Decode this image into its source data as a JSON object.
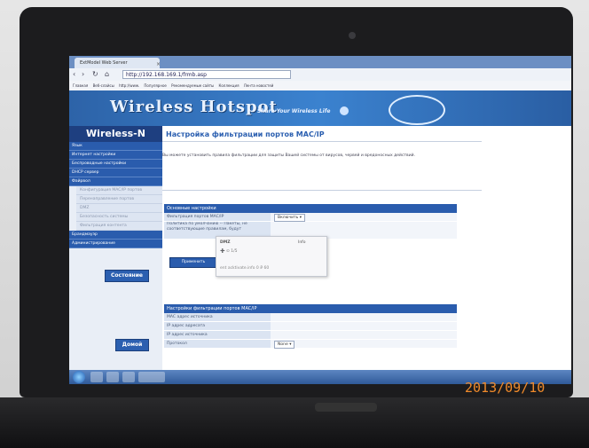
{
  "browser": {
    "tab_title": "ExtModel Web Server",
    "url": "http://192.168.169.1/frmb.asp",
    "bookmarks": [
      "Главная",
      "Веб-слайсы",
      "http://www.",
      "Популярное",
      "Рекомендуемые сайты",
      "Коллекция",
      "Лента новостей"
    ]
  },
  "banner": {
    "title": "Wireless Hotspot",
    "slogan": "Share Your Wireless Life"
  },
  "sidebar": {
    "heading": "Wireless-N",
    "items": [
      "Язык",
      "Интернет настройки",
      "Беспроводные настройки",
      "DHCP сервер",
      "Файрвол"
    ],
    "firewall_subitems": [
      "Конфигурация MAC/IP портов",
      "Перенаправление портов",
      "DMZ",
      "Безопасность системы",
      "Фильтрация контента"
    ],
    "bottom_items": [
      "Брандмауэр",
      "Администрирование"
    ],
    "status_button": "Состояние",
    "home_button": "Домой"
  },
  "main": {
    "heading": "Настройка фильтрации портов MAC/IP",
    "description": "Вы можете установить правила фильтрации для защиты Вашей системы от вирусов, червей и вредоносных действий.",
    "basic_settings": {
      "title": "Основные настройки",
      "rows": [
        {
          "label": "Фильтрация портов MAC/IP",
          "value": "Включить"
        },
        {
          "label": "Политика по умолчанию -- Пакеты, не соответствующие правилам, будут",
          "value": ""
        }
      ],
      "apply_button": "Применить"
    },
    "popup": {
      "title": "DMZ",
      "right": "Info",
      "line2": "➕ ⊙ 1/5",
      "line3": "ent  acktivate.info    0 ₽ 60"
    },
    "filter_settings": {
      "title": "Настройки фильтрации портов MAC/IP",
      "rows": [
        {
          "label": "MAC адрес источника",
          "value": ""
        },
        {
          "label": "IP адрес адресата",
          "value": ""
        },
        {
          "label": "IP адрес источника",
          "value": ""
        },
        {
          "label": "Протокол",
          "value": "None"
        }
      ]
    }
  },
  "photo": {
    "date_stamp": "2013/09/10"
  }
}
